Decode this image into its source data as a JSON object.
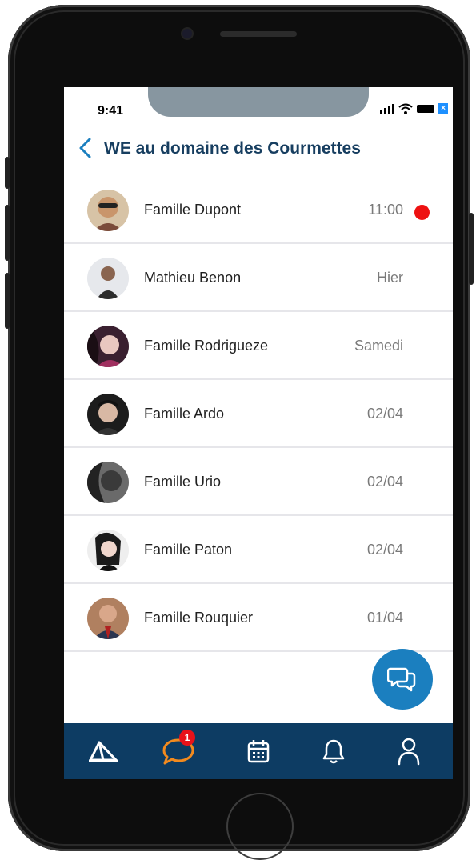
{
  "status_bar": {
    "time": "9:41",
    "close_label": "×"
  },
  "header": {
    "title": "WE au domaine des Courmettes"
  },
  "conversations": [
    {
      "name": "Famille Dupont",
      "time": "11:00",
      "unread": true,
      "avatar_color": "#c9956b"
    },
    {
      "name": "Mathieu Benon",
      "time": "Hier",
      "unread": false,
      "avatar_color": "#d9dbe0"
    },
    {
      "name": "Famille Rodrigueze",
      "time": "Samedi",
      "unread": false,
      "avatar_color": "#4a2a3a"
    },
    {
      "name": "Famille Ardo",
      "time": "02/04",
      "unread": false,
      "avatar_color": "#2a2a2a"
    },
    {
      "name": "Famille Urio",
      "time": "02/04",
      "unread": false,
      "avatar_color": "#555555"
    },
    {
      "name": "Famille Paton",
      "time": "02/04",
      "unread": false,
      "avatar_color": "#e0e0e0"
    },
    {
      "name": "Famille Rouquier",
      "time": "01/04",
      "unread": false,
      "avatar_color": "#8a6a50"
    }
  ],
  "tabbar": {
    "tabs": [
      "camp-icon",
      "chat-icon",
      "calendar-icon",
      "bell-icon",
      "profile-icon"
    ],
    "chat_badge": "1",
    "active_color": "#f28a1e",
    "icon_color": "#ffffff"
  },
  "colors": {
    "accent": "#1b7fbf",
    "navy": "#0d3c63",
    "unread": "#ee1111"
  }
}
